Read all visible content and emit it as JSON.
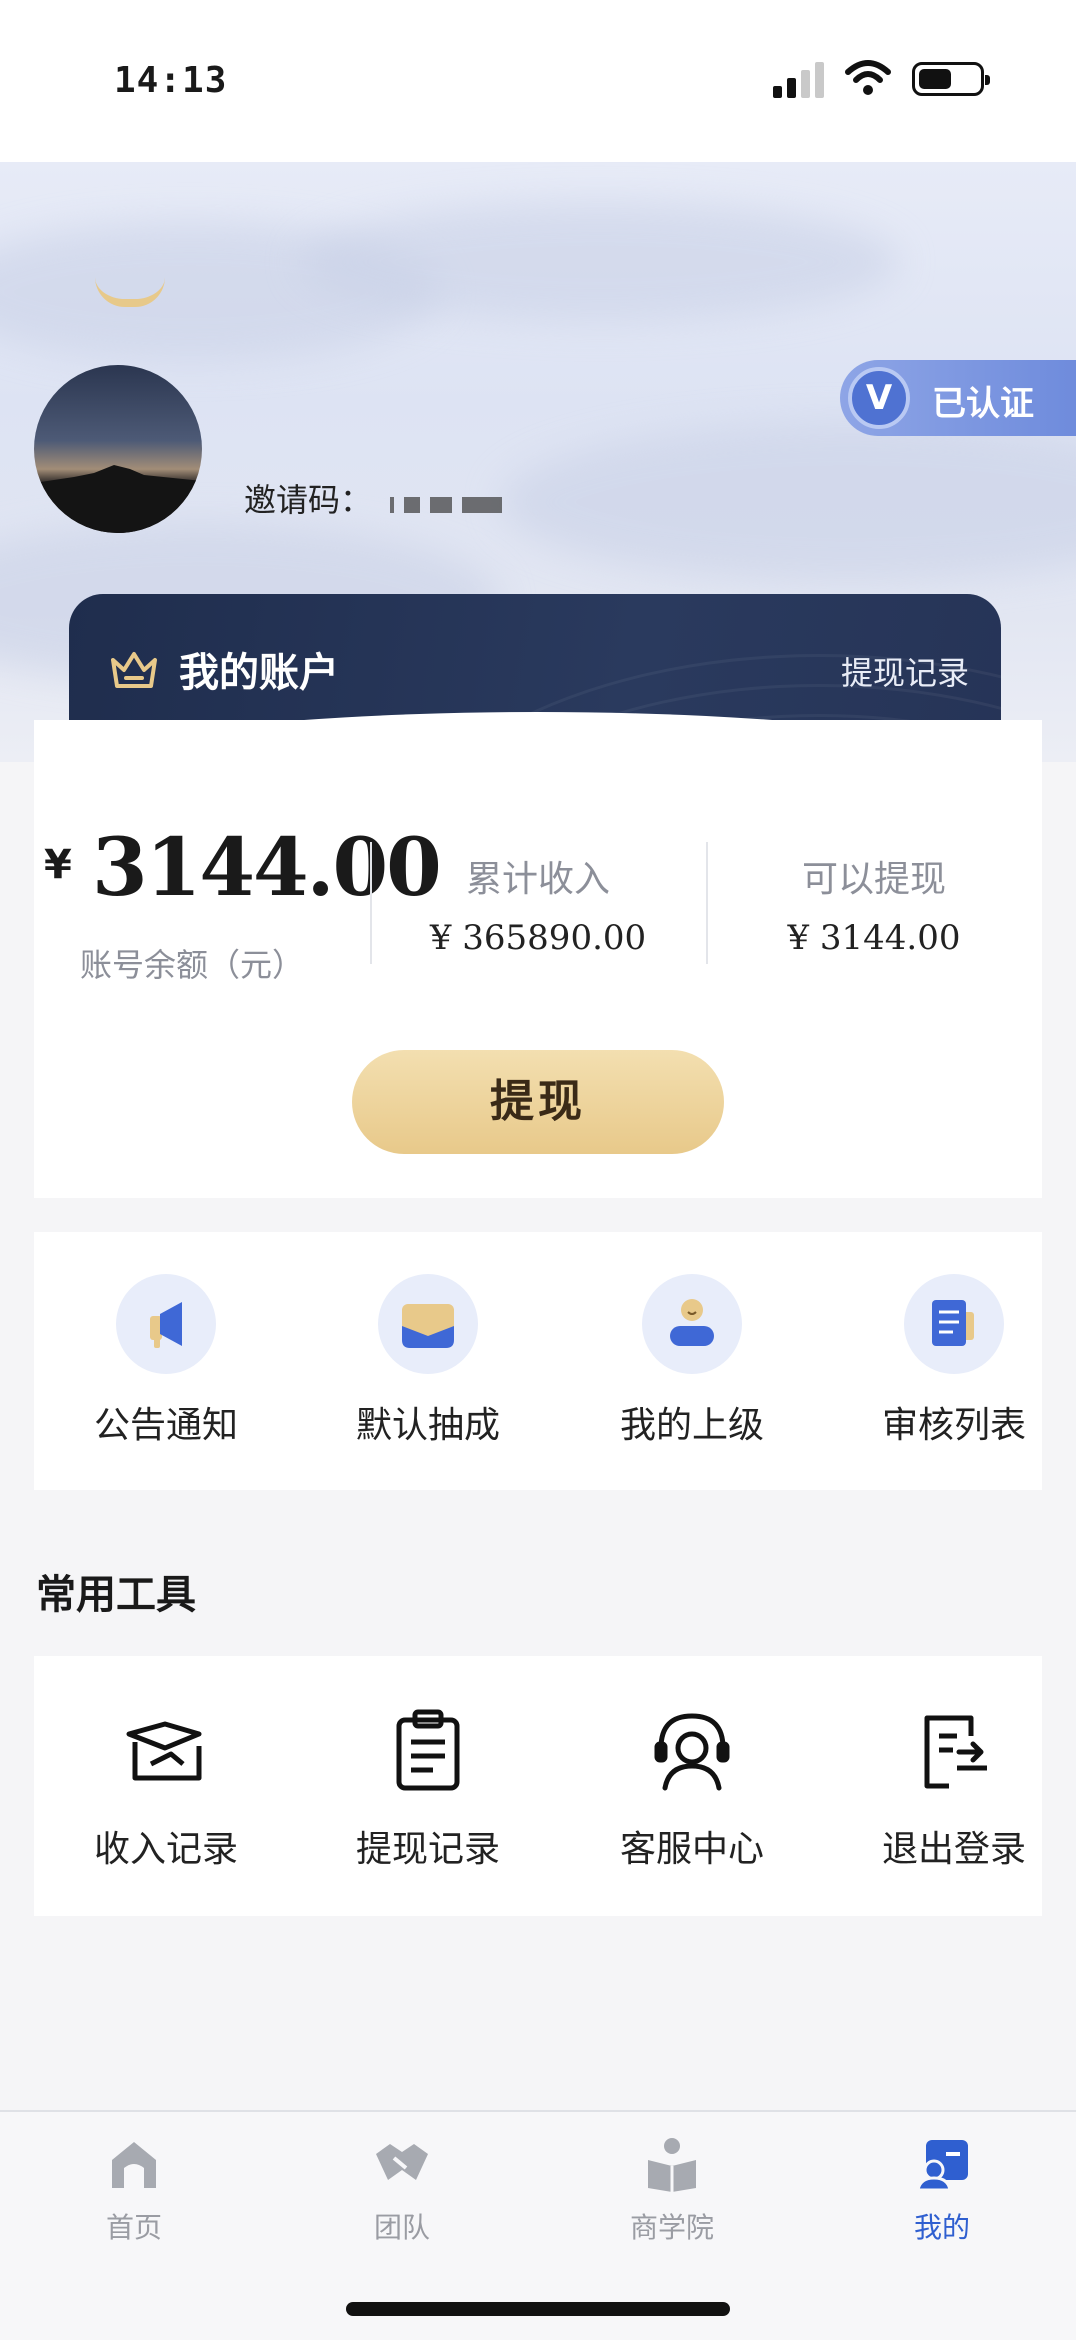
{
  "status": {
    "time": "14:13"
  },
  "profile": {
    "verified_label": "已认证",
    "invite_label": "邀请码："
  },
  "account": {
    "title": "我的账户",
    "history_link": "提现记录",
    "currency": "¥",
    "balance": "3144.00",
    "balance_label": "账号余额（元）",
    "total_income_label": "累计收入",
    "total_income_value": "¥ 365890.00",
    "withdrawable_label": "可以提现",
    "withdrawable_value": "¥ 3144.00",
    "withdraw_button": "提现"
  },
  "quick_actions": [
    {
      "label": "公告通知",
      "icon": "megaphone-icon"
    },
    {
      "label": "默认抽成",
      "icon": "envelope-icon"
    },
    {
      "label": "我的上级",
      "icon": "person-icon"
    },
    {
      "label": "审核列表",
      "icon": "document-list-icon"
    }
  ],
  "tools": {
    "title": "常用工具",
    "items": [
      {
        "label": "收入记录",
        "icon": "income-record-icon"
      },
      {
        "label": "提现记录",
        "icon": "clipboard-icon"
      },
      {
        "label": "客服中心",
        "icon": "headset-icon"
      },
      {
        "label": "退出登录",
        "icon": "logout-icon"
      }
    ]
  },
  "tabbar": [
    {
      "label": "首页",
      "icon": "home-icon"
    },
    {
      "label": "团队",
      "icon": "handshake-icon"
    },
    {
      "label": "商学院",
      "icon": "book-reader-icon"
    },
    {
      "label": "我的",
      "icon": "user-card-icon",
      "active": true
    }
  ],
  "colors": {
    "accent": "#2f5fd0",
    "gold": "#e8c98a",
    "navy": "#1f2d4d"
  }
}
